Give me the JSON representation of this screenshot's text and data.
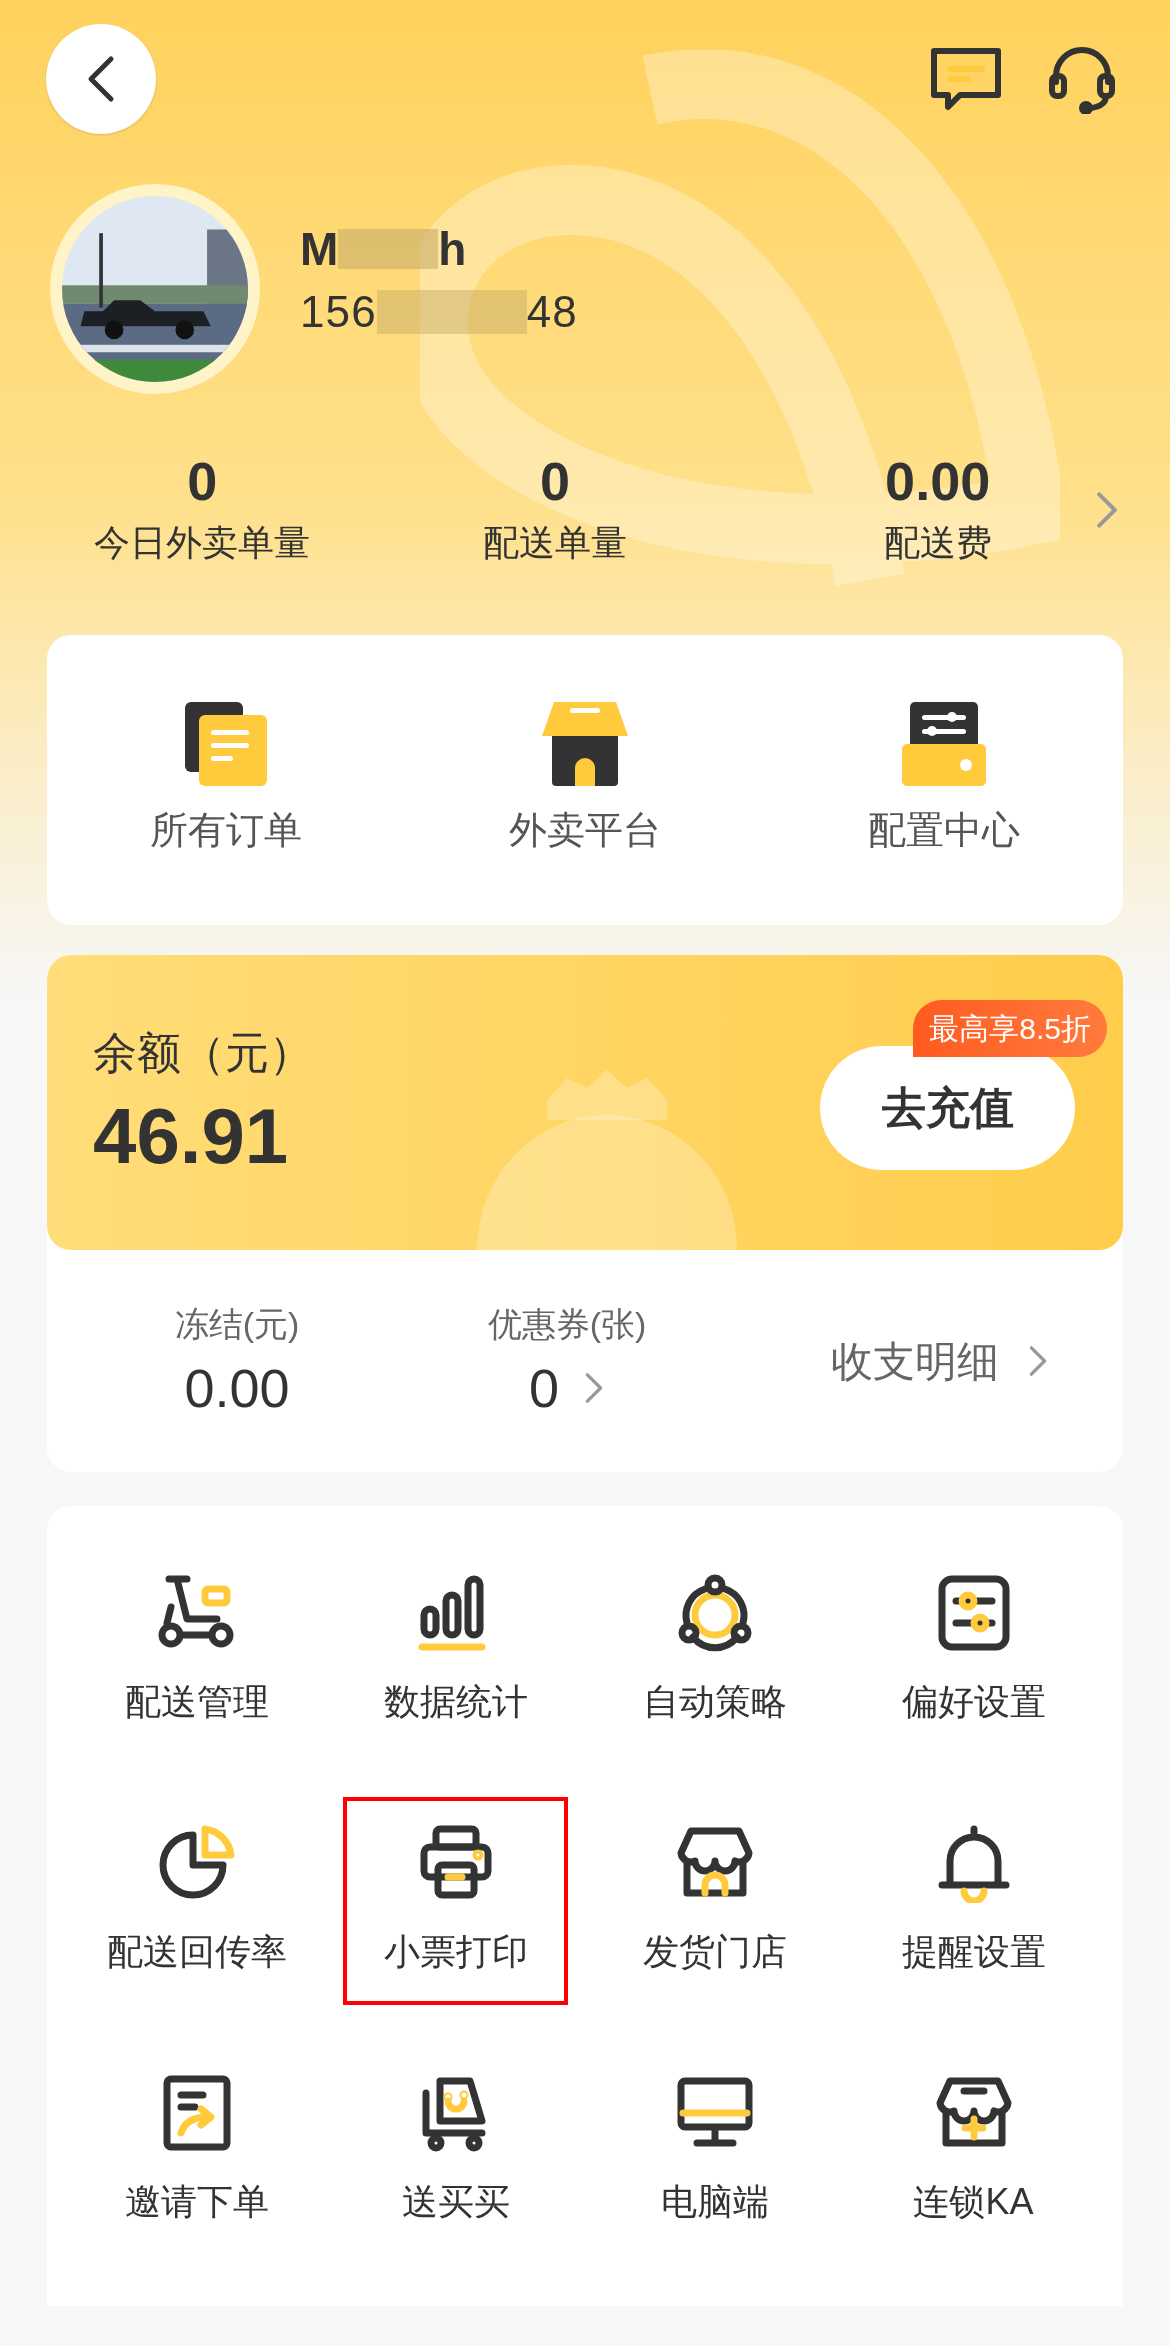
{
  "profile": {
    "name_start": "M",
    "name_end": "h",
    "phone_start": "156",
    "phone_end": "48"
  },
  "stats": [
    {
      "value": "0",
      "label": "今日外卖单量"
    },
    {
      "value": "0",
      "label": "配送单量"
    },
    {
      "value": "0.00",
      "label": "配送费"
    }
  ],
  "shortcuts": [
    {
      "label": "所有订单"
    },
    {
      "label": "外卖平台"
    },
    {
      "label": "配置中心"
    }
  ],
  "balance": {
    "label": "余额（元）",
    "amount": "46.91",
    "button": "去充值",
    "promo_badge": "最高享8.5折"
  },
  "wallet": [
    {
      "label": "冻结(元)",
      "value": "0.00",
      "arrow": false
    },
    {
      "label": "优惠券(张)",
      "value": "0",
      "arrow": true
    }
  ],
  "details_link": "收支明细",
  "tools": [
    {
      "label": "配送管理",
      "highlighted": false
    },
    {
      "label": "数据统计",
      "highlighted": false
    },
    {
      "label": "自动策略",
      "highlighted": false
    },
    {
      "label": "偏好设置",
      "highlighted": false
    },
    {
      "label": "配送回传率",
      "highlighted": false
    },
    {
      "label": "小票打印",
      "highlighted": true
    },
    {
      "label": "发货门店",
      "highlighted": false
    },
    {
      "label": "提醒设置",
      "highlighted": false
    },
    {
      "label": "邀请下单",
      "highlighted": false
    },
    {
      "label": "送买买",
      "highlighted": false
    },
    {
      "label": "电脑端",
      "highlighted": false
    },
    {
      "label": "连锁KA",
      "highlighted": false
    }
  ]
}
